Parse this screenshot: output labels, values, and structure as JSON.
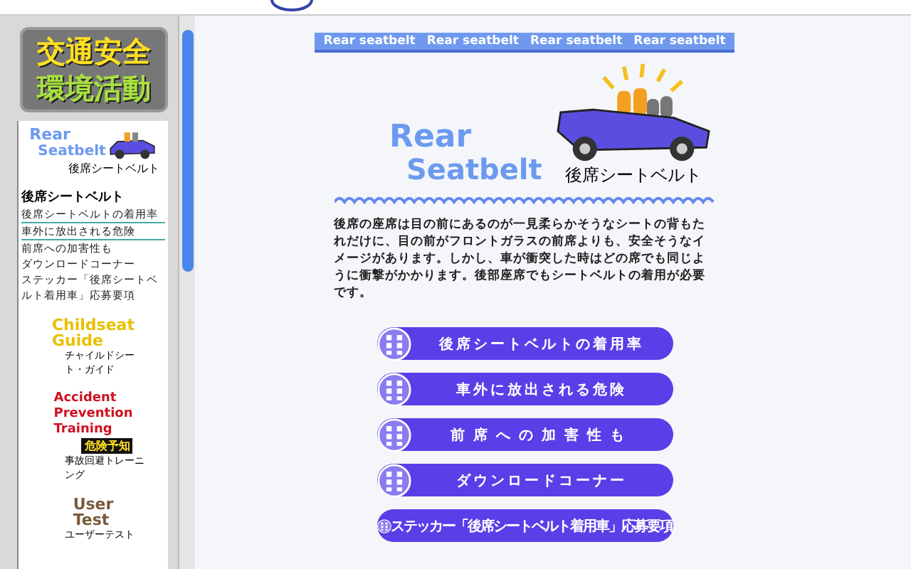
{
  "sidebar": {
    "logo": [
      "交通安全",
      "環境活動"
    ],
    "current_section": {
      "logo": [
        "Rear",
        "Seatbelt"
      ],
      "caption": "後席シートベルト",
      "heading": "後席シートベルト",
      "links": [
        {
          "label": "後席シートベルトの着用率",
          "selected": false
        },
        {
          "label": "車外に放出される危険",
          "selected": true
        },
        {
          "label": "前席への加害性も",
          "selected": false
        },
        {
          "label": "ダウンロードコーナー",
          "selected": false
        },
        {
          "label": "ステッカー「後席シートベルト着用車」応募要項",
          "selected": false
        }
      ]
    },
    "sections": [
      {
        "kind": "childseat",
        "logo": [
          "Childseat",
          "Guide"
        ],
        "caption": "チャイルドシート・ガイド"
      },
      {
        "kind": "accident",
        "logo": [
          "Accident",
          "Prevention",
          "Training"
        ],
        "badge": "危険予知",
        "caption": "事故回避トレーニング"
      },
      {
        "kind": "user",
        "logo": [
          "User",
          "Test"
        ],
        "caption": "ユーザーテスト"
      }
    ]
  },
  "tabs": [
    {
      "label": "Rear seatbelt"
    },
    {
      "label": "Rear seatbelt"
    },
    {
      "label": "Rear seatbelt"
    },
    {
      "label": "Rear seatbelt"
    }
  ],
  "hero": {
    "logo": [
      "Rear",
      "Seatbelt"
    ],
    "caption": "後席シートベルト"
  },
  "intro": "後席の座席は目の前にあるのが一見柔らかそうなシートの背もたれだけに、目の前がフロントガラスの前席よりも、安全そうなイメージがあります。しかし、車が衝突した時はどの席でも同じように衝撃がかかります。後部座席でもシートベルトの着用が必要です。",
  "menu": [
    {
      "label": "後席シートベルトの着用率",
      "kind": "spaced"
    },
    {
      "label": "車外に放出される危険",
      "kind": "spaced"
    },
    {
      "label": "前席への加害性も",
      "kind": "wide"
    },
    {
      "label": "ダウンロードコーナー",
      "kind": "spaced"
    },
    {
      "label": "ステッカー「後席シートベルト着用車」応募要項",
      "kind": "tight"
    }
  ]
}
